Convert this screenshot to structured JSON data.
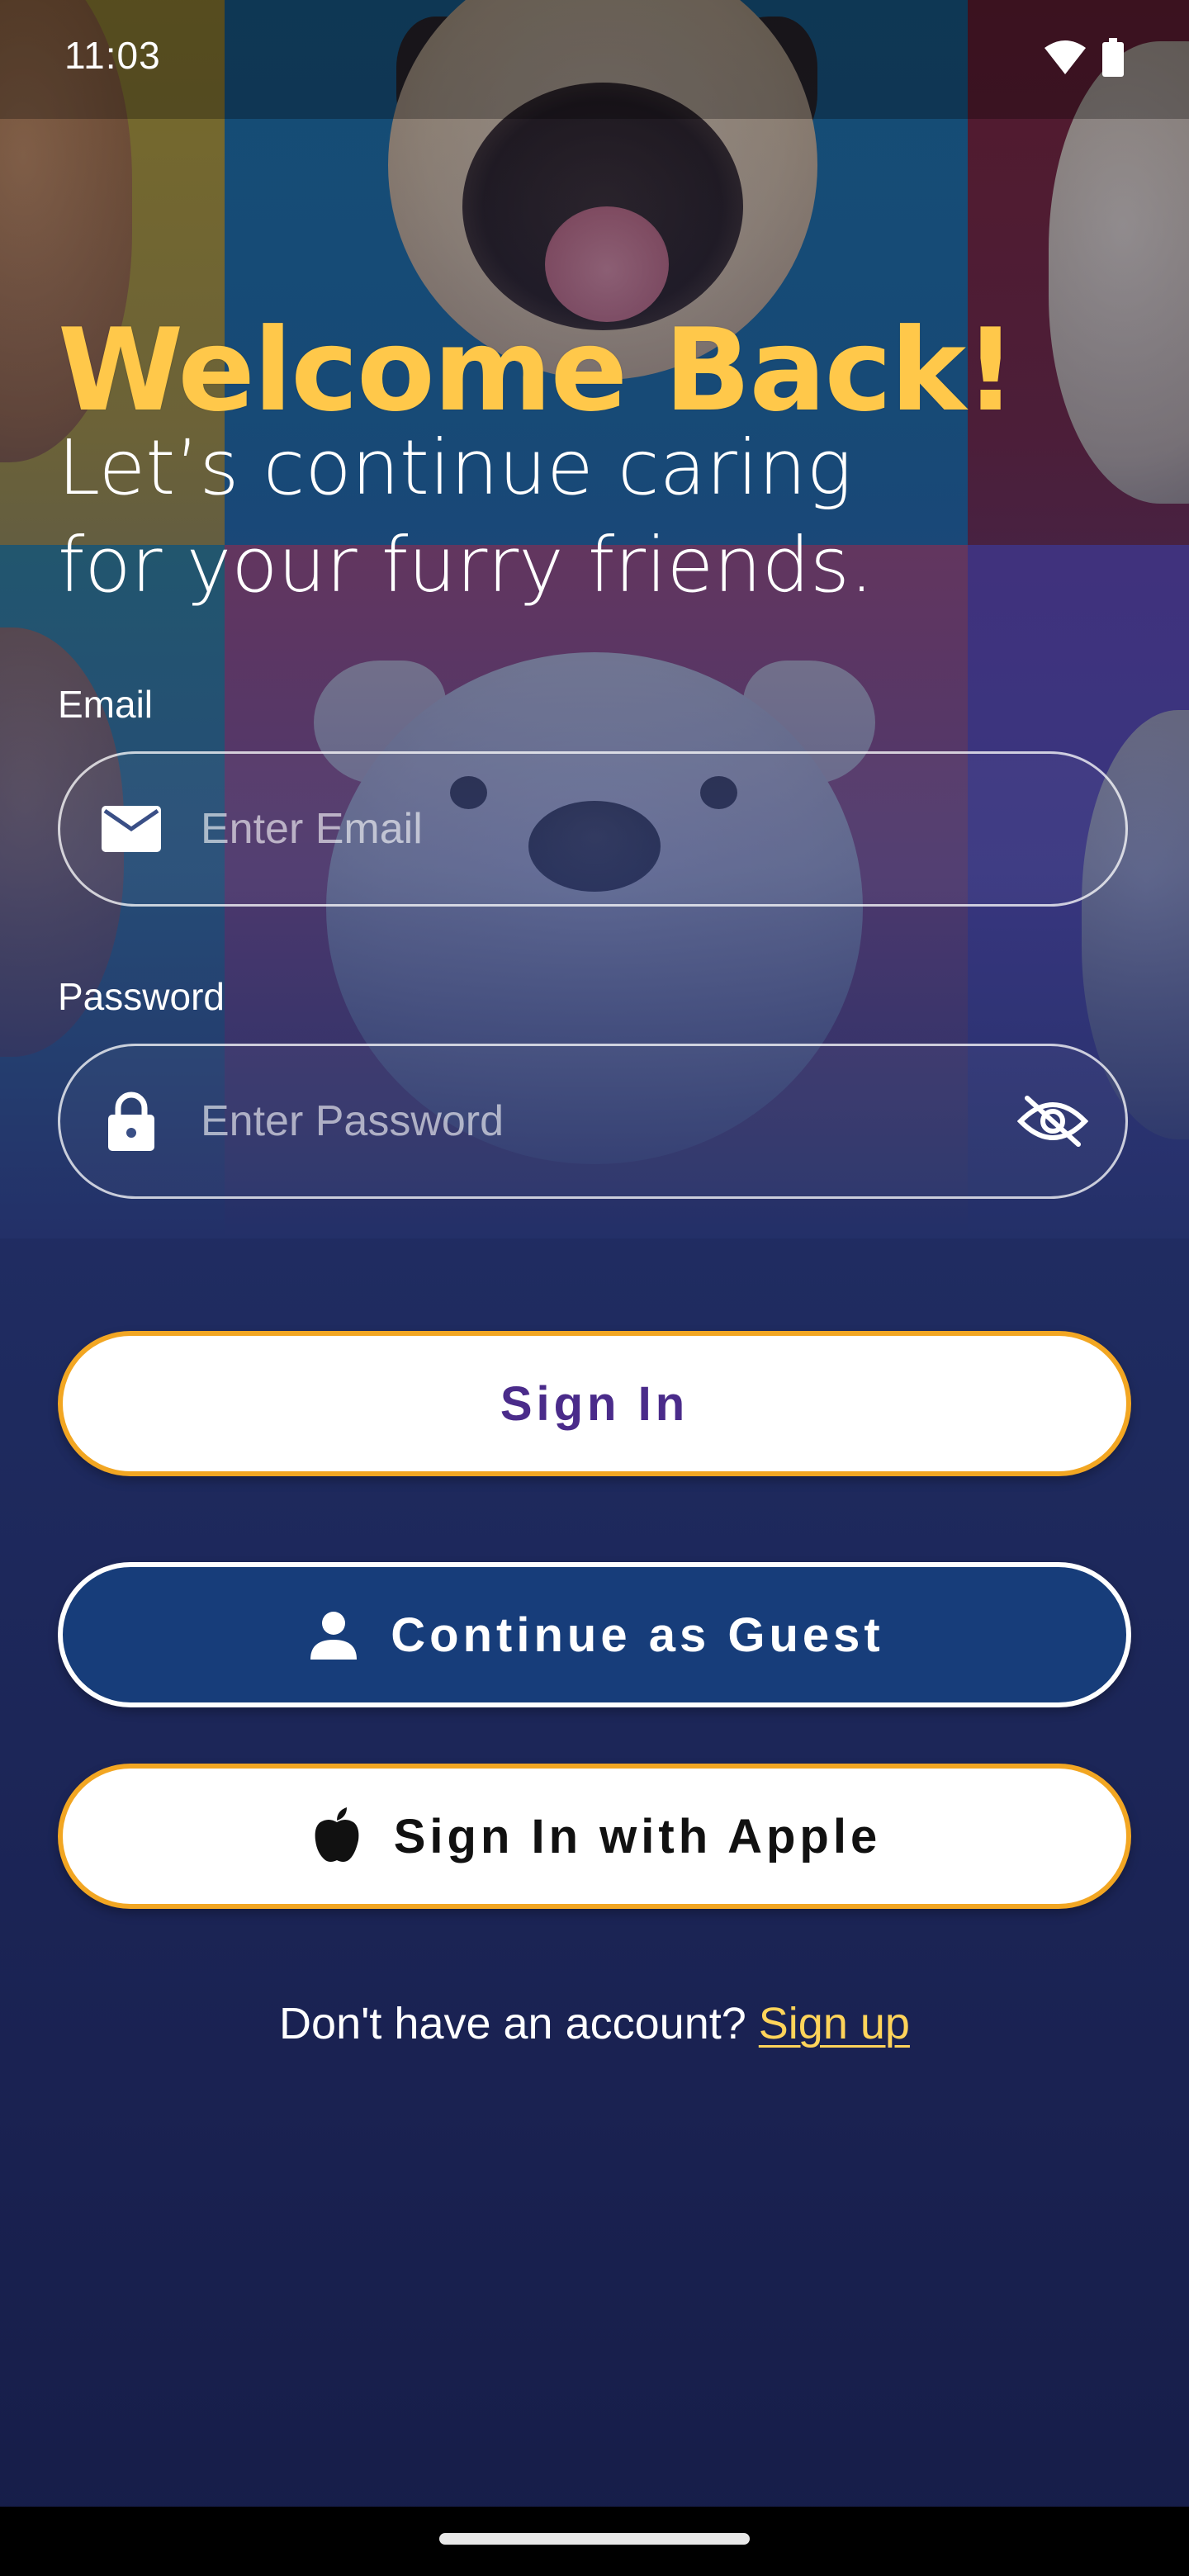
{
  "status_bar": {
    "time": "11:03",
    "icons": [
      "wifi-icon",
      "battery-icon"
    ]
  },
  "header": {
    "title": "Welcome Back!",
    "subtitle": "Let’s continue caring for your furry friends."
  },
  "form": {
    "email": {
      "label": "Email",
      "placeholder": "Enter Email",
      "value": "",
      "icon": "mail-icon"
    },
    "password": {
      "label": "Password",
      "placeholder": "Enter Password",
      "value": "",
      "icon": "lock-icon",
      "toggle_icon": "eye-off-icon"
    }
  },
  "buttons": {
    "sign_in": "Sign In",
    "guest": "Continue as Guest",
    "apple": "Sign In with Apple"
  },
  "footer": {
    "prompt": "Don't have an account?",
    "link": "Sign up"
  },
  "colors": {
    "accent": "#ffc84a",
    "border_orange": "#f2a622",
    "primary_text": "#4a2b8a",
    "guest_button": "#173d7a",
    "link": "#ffd45a"
  }
}
